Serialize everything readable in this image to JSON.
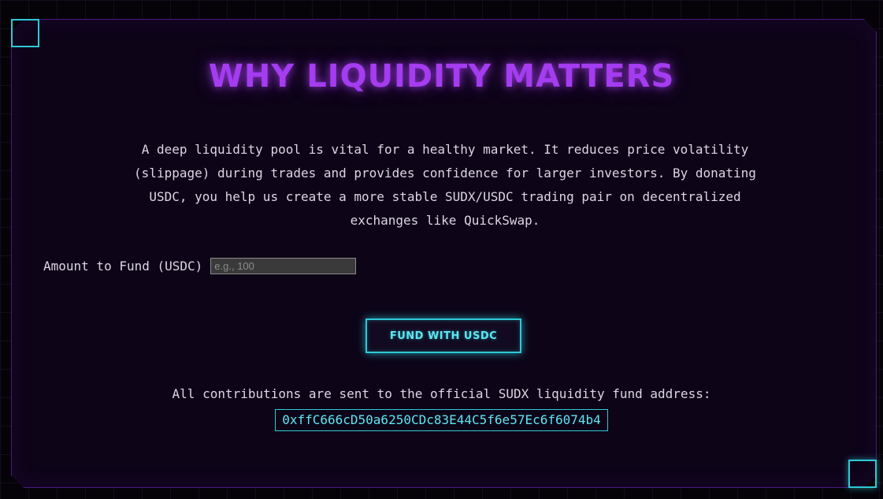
{
  "section": {
    "title": "WHY LIQUIDITY MATTERS",
    "description": "A deep liquidity pool is vital for a healthy market. It reduces price volatility (slippage) during trades and provides confidence for larger investors. By donating USDC, you help us create a more stable SUDX/USDC trading pair on decentralized exchanges like QuickSwap."
  },
  "form": {
    "amount_label": "Amount to Fund (USDC)",
    "amount_placeholder": "e.g., 100",
    "amount_value": "",
    "fund_button_label": "FUND WITH USDC"
  },
  "contribution": {
    "text": "All contributions are sent to the official SUDX liquidity fund address:",
    "address": "0xffC666cD50a6250CDc83E44C5f6e57Ec6f6074b4"
  },
  "colors": {
    "title_purple": "#a43cf0",
    "accent_cyan": "#2ec9d6",
    "panel_bg": "#0d0418",
    "page_bg": "#050308",
    "text": "#dcd7e2"
  }
}
